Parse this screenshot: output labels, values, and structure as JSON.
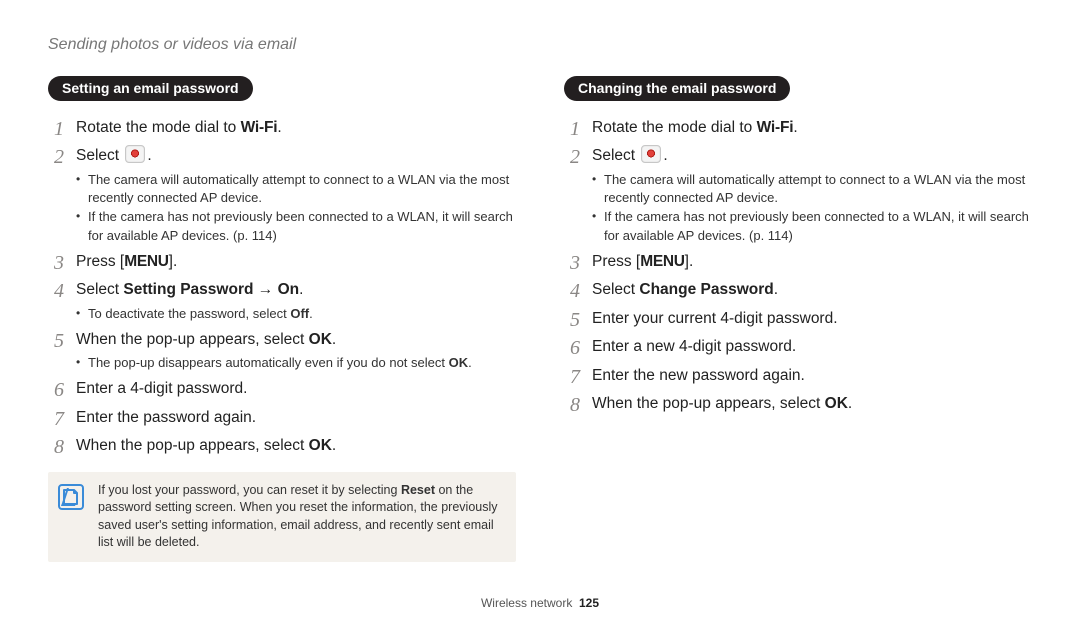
{
  "page": {
    "section_header": "Sending photos or videos via email",
    "footer_label": "Wireless network",
    "page_number": "125"
  },
  "left": {
    "pill": "Setting an email password",
    "steps": {
      "s1_pre": "Rotate the mode dial to ",
      "s1_wifi": "Wi-Fi",
      "s1_post": ".",
      "s2_pre": "Select ",
      "s2_post": ".",
      "s2_sub1": "The camera will automatically attempt to connect to a WLAN via the most recently connected AP device.",
      "s2_sub2": "If the camera has not previously been connected to a WLAN, it will search for available AP devices. (p. 114)",
      "s3_pre": "Press [",
      "s3_menu": "MENU",
      "s3_post": "].",
      "s4_pre": "Select ",
      "s4_bold": "Setting Password",
      "s4_arrow": " → ",
      "s4_bold2": "On",
      "s4_post": ".",
      "s4_sub1_pre": "To deactivate the password, select ",
      "s4_sub1_bold": "Off",
      "s4_sub1_post": ".",
      "s5_pre": "When the pop-up appears, select ",
      "s5_bold": "OK",
      "s5_post": ".",
      "s5_sub1_pre": "The pop-up disappears automatically even if you do not select ",
      "s5_sub1_bold": "OK",
      "s5_sub1_post": ".",
      "s6": "Enter a 4-digit password.",
      "s7": "Enter the password again.",
      "s8_pre": "When the pop-up appears, select ",
      "s8_bold": "OK",
      "s8_post": "."
    },
    "note_pre": "If you lost your password, you can reset it by selecting ",
    "note_bold": "Reset",
    "note_post": " on the password setting screen. When you reset the information, the previously saved user's setting information, email address, and recently sent email list will be deleted."
  },
  "right": {
    "pill": "Changing the email password",
    "steps": {
      "s1_pre": "Rotate the mode dial to ",
      "s1_wifi": "Wi-Fi",
      "s1_post": ".",
      "s2_pre": "Select ",
      "s2_post": ".",
      "s2_sub1": "The camera will automatically attempt to connect to a WLAN via the most recently connected AP device.",
      "s2_sub2": "If the camera has not previously been connected to a WLAN, it will search for available AP devices. (p. 114)",
      "s3_pre": "Press [",
      "s3_menu": "MENU",
      "s3_post": "].",
      "s4_pre": "Select ",
      "s4_bold": "Change Password",
      "s4_post": ".",
      "s5": "Enter your current 4-digit password.",
      "s6": "Enter a new 4-digit password.",
      "s7": "Enter the new password again.",
      "s8_pre": "When the pop-up appears, select ",
      "s8_bold": "OK",
      "s8_post": "."
    }
  }
}
